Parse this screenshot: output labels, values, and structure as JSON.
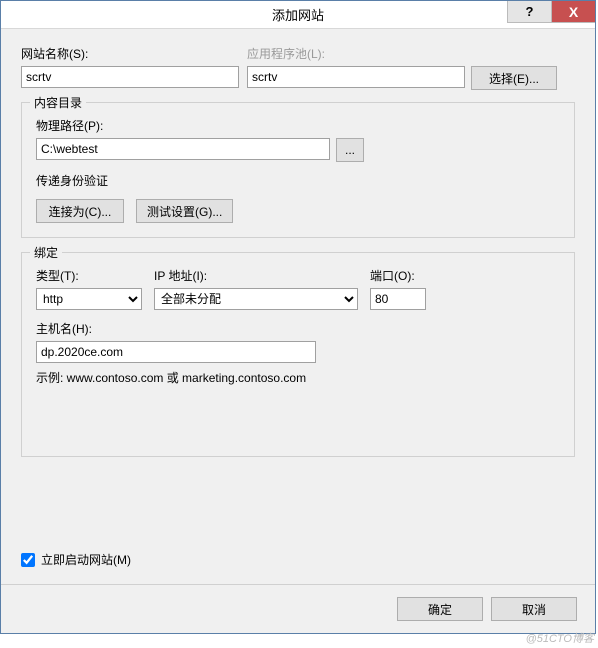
{
  "titlebar": {
    "title": "添加网站",
    "help": "?",
    "close": "X"
  },
  "siteName": {
    "label": "网站名称(S):",
    "value": "scrtv"
  },
  "appPool": {
    "label": "应用程序池(L):",
    "value": "scrtv",
    "selectBtn": "选择(E)..."
  },
  "contentDir": {
    "legend": "内容目录",
    "pathLabel": "物理路径(P):",
    "pathValue": "C:\\webtest",
    "browse": "...",
    "passthroughLabel": "传递身份验证",
    "connectAs": "连接为(C)...",
    "testSettings": "测试设置(G)..."
  },
  "binding": {
    "legend": "绑定",
    "typeLabel": "类型(T):",
    "typeValue": "http",
    "ipLabel": "IP 地址(I):",
    "ipValue": "全部未分配",
    "portLabel": "端口(O):",
    "portValue": "80",
    "hostLabel": "主机名(H):",
    "hostValue": "dp.2020ce.com",
    "example": "示例: www.contoso.com 或 marketing.contoso.com"
  },
  "startNow": {
    "label": "立即启动网站(M)",
    "checked": true
  },
  "footer": {
    "ok": "确定",
    "cancel": "取消"
  },
  "watermark": "@51CTO博客"
}
